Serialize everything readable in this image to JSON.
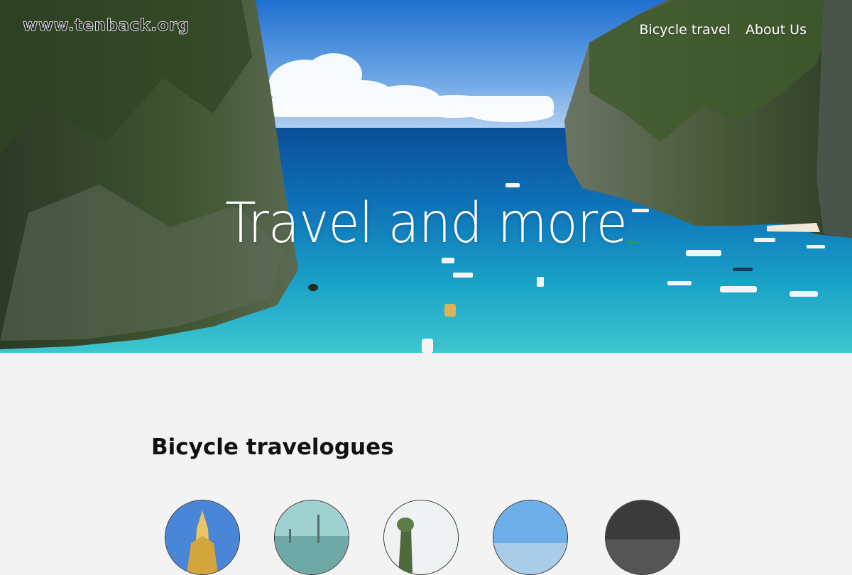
{
  "site": {
    "logo_text": "www.tenback.org"
  },
  "nav": {
    "items": [
      {
        "label": "Bicycle travel"
      },
      {
        "label": "About Us"
      }
    ]
  },
  "hero": {
    "title": "Travel and more"
  },
  "section": {
    "title": "Bicycle travelogues",
    "thumbnails": [
      {
        "icon": "temple-photo"
      },
      {
        "icon": "harbor-photo"
      },
      {
        "icon": "tree-photo"
      },
      {
        "icon": "sky-photo"
      },
      {
        "icon": "dark-photo"
      }
    ]
  }
}
